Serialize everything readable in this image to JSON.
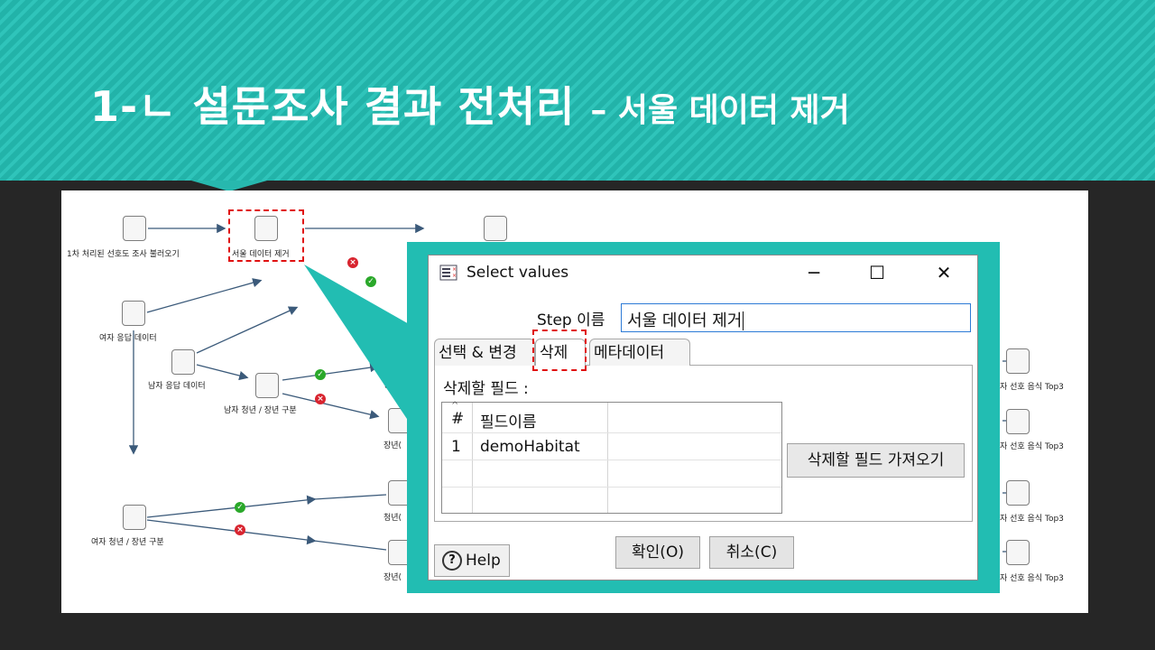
{
  "slide": {
    "title_main": "1-ㄴ 설문조사 결과 전처리 ",
    "title_sub": "– 서울 데이터 제거"
  },
  "workflow": {
    "nodes": {
      "load": "1차 처리된 선호도 조사 불러오기",
      "seoul_remove": "서울 데이터 제거",
      "female": "여자 응답 데이터",
      "male": "남자 응답 데이터",
      "male_split": "남자 청년 / 장년 구분",
      "female_split": "여자 청년 / 장년 구분",
      "youth_a": "청년(",
      "senior_a": "장년(",
      "youth_b": "청년(",
      "senior_b": "장년(",
      "out1": "자 선호 음식 Top3",
      "out2": "자 선호 음식 Top3",
      "out3": "자 선호 음식 Top3",
      "out4": "자 선호 음식 Top3"
    }
  },
  "dialog": {
    "title": "Select values",
    "step_name_label": "Step 이름",
    "step_name_value": "서울 데이터 제거",
    "tabs": [
      "선택 & 변경",
      "삭제",
      "메타데이터"
    ],
    "active_tab": "삭제",
    "fields_label": "삭제할 필드 :",
    "grid": {
      "col_index": "#",
      "col_name": "필드이름",
      "rows": [
        {
          "index": "1",
          "name": "demoHabitat"
        }
      ]
    },
    "get_fields_button": "삭제할 필드 가져오기",
    "ok_button": "확인(O)",
    "cancel_button": "취소(C)",
    "help_button": "Help"
  },
  "colors": {
    "banner": "#22b3a9",
    "callout": "#22bdb2",
    "highlight": "#e01010"
  }
}
